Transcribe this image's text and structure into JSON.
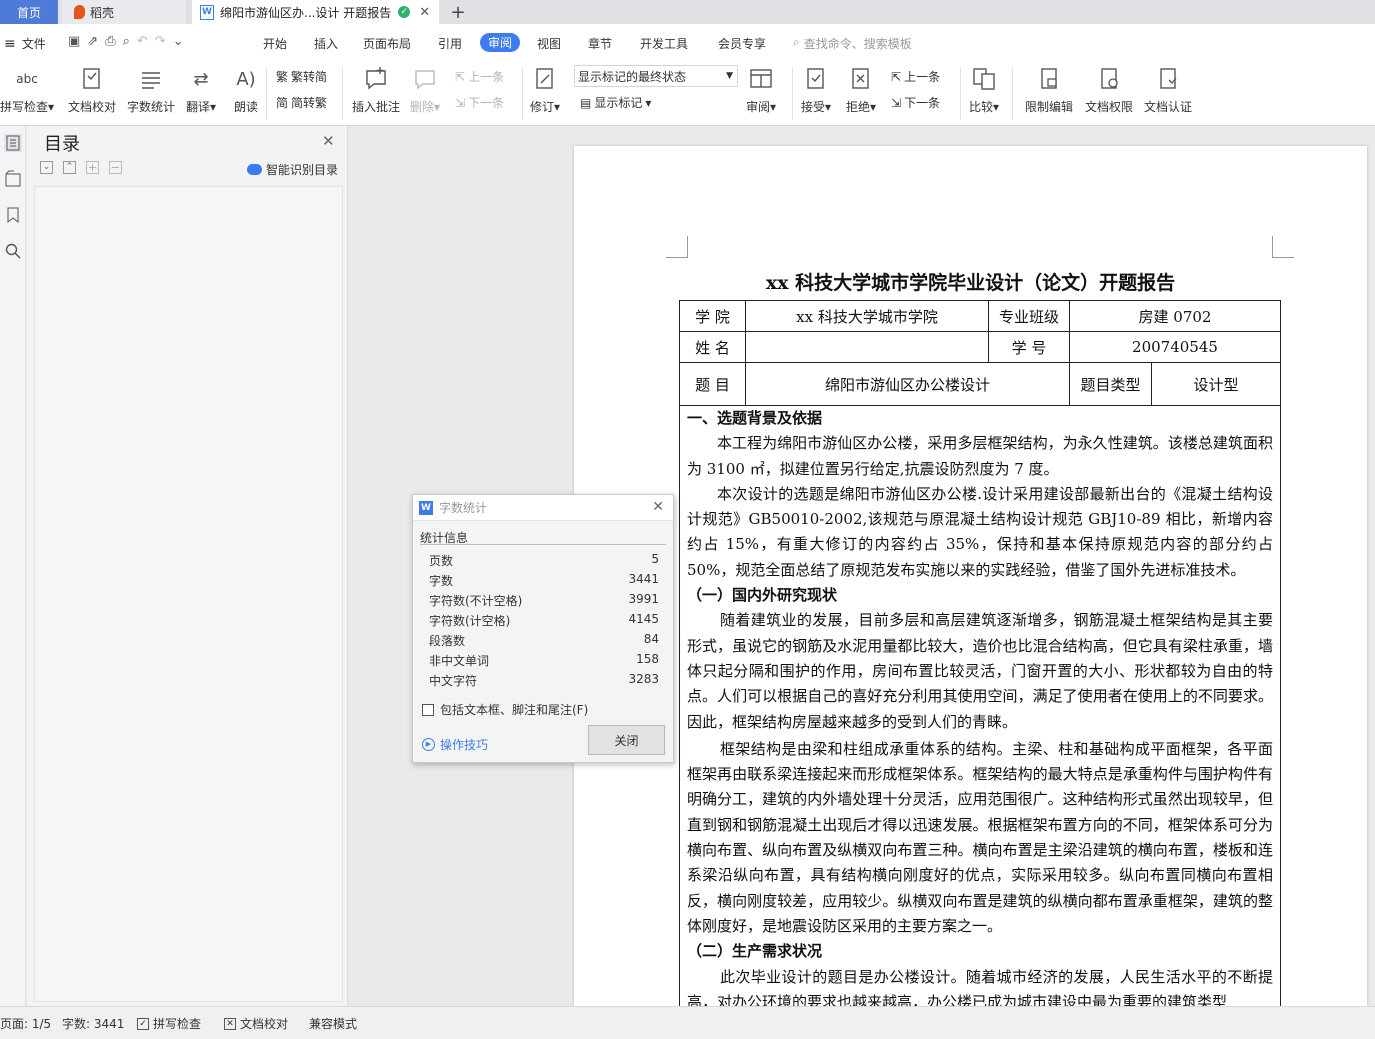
{
  "tabs": {
    "home": "首页",
    "daoke": "稻壳",
    "doc": "绵阳市游仙区办...设计 开题报告"
  },
  "menu": {
    "file": "文件",
    "items": [
      "开始",
      "插入",
      "页面布局",
      "引用",
      "审阅",
      "视图",
      "章节",
      "开发工具",
      "会员专享"
    ],
    "search": "查找命令、搜索模板"
  },
  "ribbon": {
    "spell": "拼写检查",
    "proof": "文档校对",
    "wordcount": "字数统计",
    "translate": "翻译",
    "read": "朗读",
    "to_trad": "繁转简",
    "to_simp": "简转繁",
    "insert_comment": "插入批注",
    "delete": "删除",
    "prev_c": "上一条",
    "next_c": "下一条",
    "revise": "修订",
    "markup_select": "显示标记的最终状态",
    "show_markup": "显示标记",
    "review": "审阅",
    "accept": "接受",
    "reject": "拒绝",
    "prev_r": "上一条",
    "next_r": "下一条",
    "compare": "比较",
    "restrict": "限制编辑",
    "doc_perm": "文档权限",
    "doc_cert": "文档认证"
  },
  "nav": {
    "title": "目录",
    "smart": "智能识别目录"
  },
  "doc": {
    "title": "xx 科技大学城市学院毕业设计（论文）开题报告",
    "table": {
      "college_label": "学  院",
      "college": "xx 科技大学城市学院",
      "class_label": "专业班级",
      "class": "房建 0702",
      "name_label": "姓  名",
      "name": "",
      "id_label": "学      号",
      "id": "200740545",
      "topic_label": "题  目",
      "topic": "绵阳市游仙区办公楼设计",
      "type_label": "题目类型",
      "type": "设计型"
    },
    "h1": "一、选题背景及依据",
    "p1": "本工程为绵阳市游仙区办公楼，采用多层框架结构，为永久性建筑。该楼总建筑面积为 3100 ㎡，拟建位置另行给定,抗震设防烈度为 7 度。",
    "p2": "本次设计的选题是绵阳市游仙区办公楼.设计采用建设部最新出台的《混凝土结构设计规范》GB50010-2002,该规范与原混凝土结构设计规范 GBJ10-89 相比，新增内容约占 15%，有重大修订的内容约占 35%，保持和基本保持原规范内容的部分约占 50%，规范全面总结了原规范发布实施以来的实践经验，借鉴了国外先进标准技术。",
    "h2": "（一）国内外研究现状",
    "p3": "随着建筑业的发展，目前多层和高层建筑逐渐增多，钢筋混凝土框架结构是其主要形式，虽说它的钢筋及水泥用量都比较大，造价也比混合结构高，但它具有梁柱承重，墙体只起分隔和围护的作用，房间布置比较灵活，门窗开置的大小、形状都较为自由的特点。人们可以根据自己的喜好充分利用其使用空间，满足了使用者在使用上的不同要求。因此，框架结构房屋越来越多的受到人们的青睐。",
    "p4": "框架结构是由梁和柱组成承重体系的结构。主梁、柱和基础构成平面框架，各平面框架再由联系梁连接起来而形成框架体系。框架结构的最大特点是承重构件与围护构件有明确分工，建筑的内外墙处理十分灵活，应用范围很广。这种结构形式虽然出现较早，但直到钢和钢筋混凝土出现后才得以迅速发展。根据框架布置方向的不同，框架体系可分为横向布置、纵向布置及纵横双向布置三种。横向布置是主梁沿建筑的横向布置，楼板和连系梁沿纵向布置，具有结构横向刚度好的优点，实际采用较多。纵向布置同横向布置相反，横向刚度较差，应用较少。纵横双向布置是建筑的纵横向都布置承重框架，建筑的整体刚度好，是地震设防区采用的主要方案之一。",
    "h3": "（二）生产需求状况",
    "p5": "此次毕业设计的题目是办公楼设计。随着城市经济的发展，人民生活水平的不断提高，对办公环境的要求也越来越高，办公楼已成为城市建设中最为重要的建筑类型"
  },
  "dialog": {
    "title": "字数统计",
    "section": "统计信息",
    "rows": [
      {
        "label": "页数",
        "value": "5"
      },
      {
        "label": "字数",
        "value": "3441"
      },
      {
        "label": "字符数(不计空格)",
        "value": "3991"
      },
      {
        "label": "字符数(计空格)",
        "value": "4145"
      },
      {
        "label": "段落数",
        "value": "84"
      },
      {
        "label": "非中文单词",
        "value": "158"
      },
      {
        "label": "中文字符",
        "value": "3283"
      }
    ],
    "checkbox": "包括文本框、脚注和尾注(F)",
    "tips": "操作技巧",
    "close": "关闭"
  },
  "status": {
    "page": "页面: 1/5",
    "words": "字数: 3441",
    "spell": "拼写检查",
    "proof": "文档校对",
    "compat": "兼容模式"
  },
  "colors": {
    "accent": "#3c7cf0",
    "home_tab": "#4e7bd8",
    "daoke": "#e8541e"
  }
}
